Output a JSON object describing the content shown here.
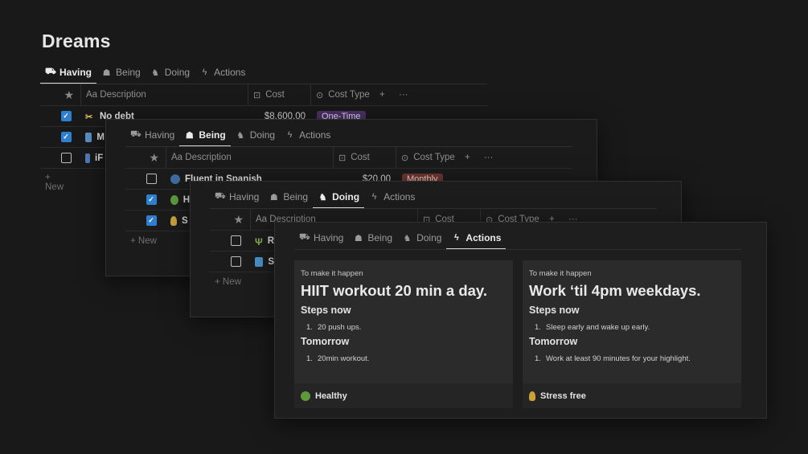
{
  "page_title": "Dreams",
  "tabs": [
    {
      "label": "Having",
      "icon": "car-icon"
    },
    {
      "label": "Being",
      "icon": "mask-icon"
    },
    {
      "label": "Doing",
      "icon": "chess-knight-icon"
    },
    {
      "label": "Actions",
      "icon": "lightning-icon"
    }
  ],
  "columns": {
    "star": "★",
    "description": "Aa Description",
    "cost": "Cost",
    "cost_type": "Cost Type",
    "add": "+",
    "more": "···"
  },
  "new_label": "+ New",
  "having": {
    "rows": [
      {
        "checked": true,
        "name": "No debt",
        "cost": "$8,600.00",
        "cost_type": "One-Time"
      },
      {
        "checked": true,
        "name": "M",
        "cost": "",
        "cost_type": ""
      },
      {
        "checked": false,
        "name": "iF",
        "cost": "",
        "cost_type": ""
      }
    ]
  },
  "being": {
    "rows": [
      {
        "checked": false,
        "name": "Fluent in Spanish",
        "cost": "$20.00",
        "cost_type": "Monthly"
      },
      {
        "checked": true,
        "name": "H",
        "cost": "",
        "cost_type": ""
      },
      {
        "checked": true,
        "name": "S",
        "cost": "",
        "cost_type": ""
      }
    ]
  },
  "doing": {
    "rows": [
      {
        "checked": false,
        "name": "R"
      },
      {
        "checked": false,
        "name": "S"
      }
    ]
  },
  "actions": {
    "cards": [
      {
        "pre": "To make it happen",
        "title": "HIIT workout 20 min a day.",
        "steps_now_heading": "Steps now",
        "steps_now": [
          "20 push ups."
        ],
        "tomorrow_heading": "Tomorrow",
        "tomorrow": [
          "20min workout."
        ],
        "tag": "Healthy"
      },
      {
        "pre": "To make it happen",
        "title": "Work ‘til 4pm weekdays.",
        "steps_now_heading": "Steps now",
        "steps_now": [
          "Sleep early and wake up early."
        ],
        "tomorrow_heading": "Tomorrow",
        "tomorrow": [
          "Work at least 90 minutes for your highlight."
        ],
        "tag": "Stress free"
      }
    ]
  },
  "colors": {
    "accent_checkbox": "#2e7fd0",
    "pill_one_time": "#4a3265",
    "pill_monthly": "#6e3630"
  }
}
